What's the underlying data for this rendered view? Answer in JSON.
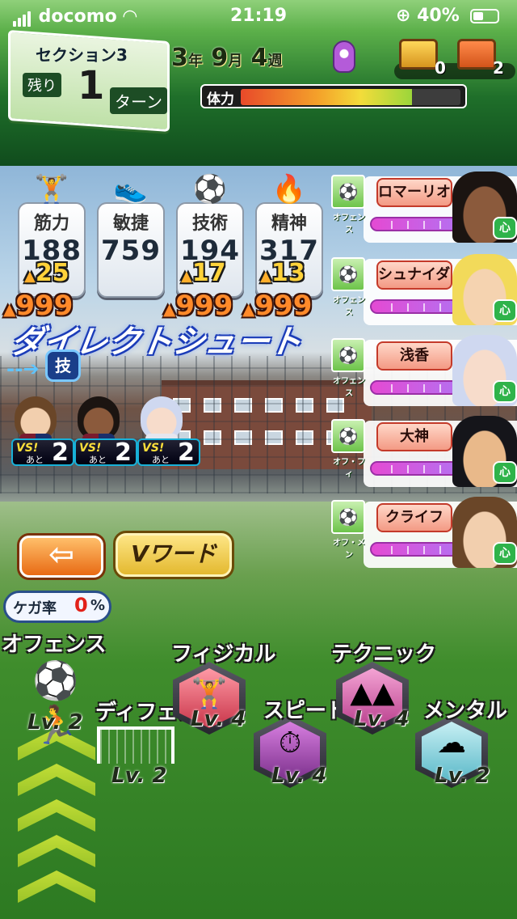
{
  "status_bar": {
    "carrier": "docomo",
    "time": "21:19",
    "battery": "40%"
  },
  "hud": {
    "section_label": "セクション3",
    "remain_label": "残り",
    "remain_turns": "1",
    "turn_label": "ターン",
    "date": {
      "year": "3",
      "year_unit": "年",
      "month": "9",
      "month_unit": "月",
      "week": "4",
      "week_unit": "週"
    },
    "chests": [
      {
        "count": "0",
        "color": "#e2a52a"
      },
      {
        "count": "2",
        "color": "#e86a2a"
      }
    ],
    "stamina": {
      "label": "体力",
      "level": 0.78
    }
  },
  "stats": [
    {
      "name": "筋力",
      "value": "188",
      "gain": "25",
      "total_gain": "999",
      "icon": "dumbbell-icon"
    },
    {
      "name": "敏捷",
      "value": "759",
      "gain": "",
      "total_gain": "",
      "icon": "shoe-icon"
    },
    {
      "name": "技術",
      "value": "194",
      "gain": "17",
      "total_gain": "999",
      "icon": "soccer-ball-icon"
    },
    {
      "name": "精神",
      "value": "317",
      "gain": "13",
      "total_gain": "999",
      "icon": "flame-icon"
    }
  ],
  "skill": {
    "name": "ダイレクトシュート",
    "badge": "技"
  },
  "versus": [
    {
      "vs": "VS!",
      "ato": "あと",
      "count": "2"
    },
    {
      "vs": "VS!",
      "ato": "あと",
      "count": "2"
    },
    {
      "vs": "VS!",
      "ato": "あと",
      "count": "2"
    }
  ],
  "roster": [
    {
      "name": "ロマーリオ",
      "role": "オフェンス",
      "heart": "心",
      "skin": "#8b5a3c",
      "hair": "#1b1411"
    },
    {
      "name": "シュナイダー",
      "role": "オフェンス",
      "heart": "心",
      "skin": "#f5d3b0",
      "hair": "#f2da5a"
    },
    {
      "name": "浅香",
      "role": "オフェンス",
      "heart": "心",
      "skin": "#f7dccb",
      "hair": "#cfd8f0"
    },
    {
      "name": "大神",
      "role": "オフ・フィ",
      "heart": "心",
      "skin": "#e9b98a",
      "hair": "#15151a"
    },
    {
      "name": "クライフ",
      "role": "オフ・メン",
      "heart": "心",
      "skin": "#f2cfae",
      "hair": "#6a4628"
    }
  ],
  "buttons": {
    "back": "⇦",
    "vword": "Vワード"
  },
  "injury": {
    "label": "ケガ率",
    "value": "0",
    "unit": "%"
  },
  "training": [
    {
      "name": "オフェンス",
      "level": "Lv. 2",
      "icon": "soccer-kick-icon"
    },
    {
      "name": "ディフェンス",
      "level": "Lv. 2",
      "icon": "goal-defense-icon"
    },
    {
      "name": "フィジカル",
      "level": "Lv. 4",
      "icon": "dumbbell-icon"
    },
    {
      "name": "スピード",
      "level": "Lv. 4",
      "icon": "stopwatch-icon"
    },
    {
      "name": "テクニック",
      "level": "Lv. 4",
      "icon": "cone-icon"
    },
    {
      "name": "メンタル",
      "level": "Lv. 2",
      "icon": "cloud-icon"
    }
  ]
}
